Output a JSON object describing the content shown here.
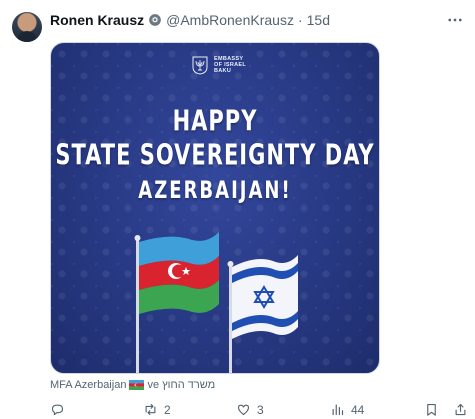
{
  "author": {
    "name": "Ronen Krausz",
    "handle": "@AmbRonenKrausz",
    "time": "15d"
  },
  "media": {
    "emblem_text": [
      "EMBASSY",
      "OF ISRAEL",
      "BAKU"
    ],
    "headline": [
      "HAPPY",
      "STATE SOVEREIGNTY DAY",
      "AZERBAIJAN!"
    ],
    "flags": [
      "azerbaijan-flag",
      "israel-flag"
    ]
  },
  "caption": {
    "left": "MFA Azerbaijan",
    "middle": "ve",
    "right": "משרד החוץ"
  },
  "actions": {
    "reply_count": "",
    "retweet_count": "2",
    "like_count": "3",
    "views_count": "44"
  },
  "colors": {
    "poster_blue": "#2a3b86",
    "az_blue": "#3f9fd8",
    "az_red": "#d9232e",
    "az_green": "#3ba552",
    "israel_blue": "#1f4fb2",
    "verified": "#1d9bf0"
  }
}
